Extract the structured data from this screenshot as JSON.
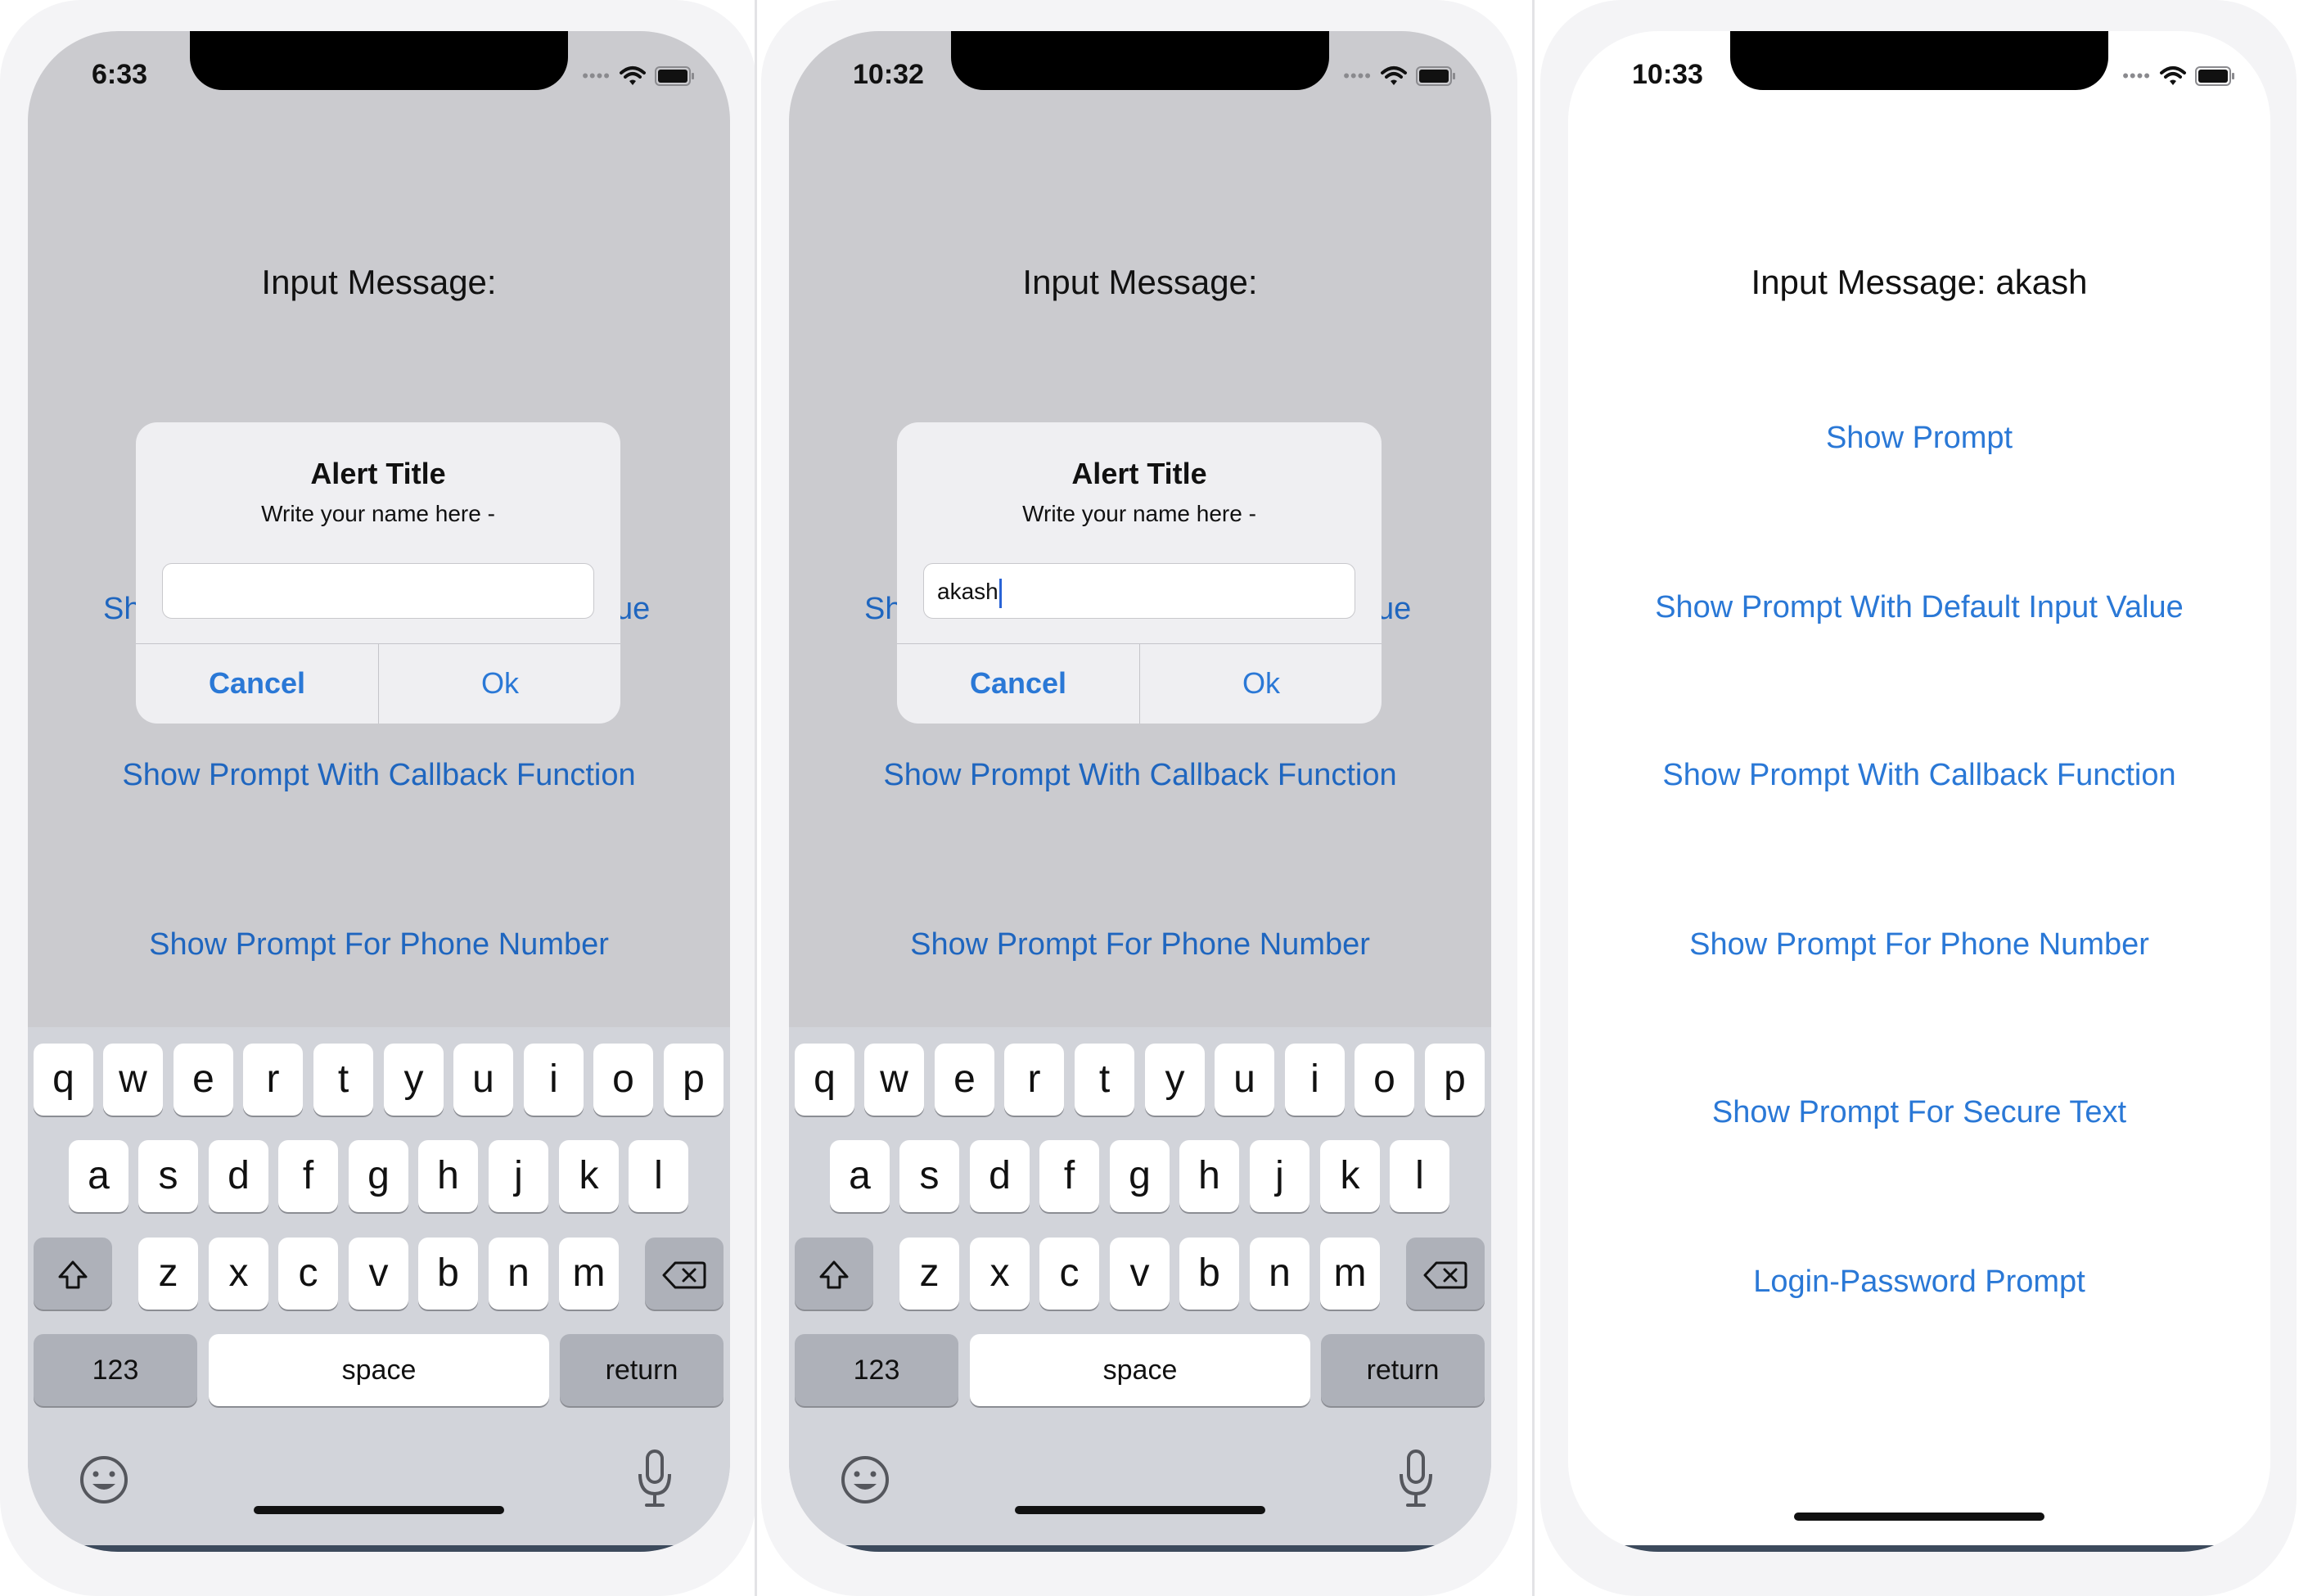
{
  "colors": {
    "link": "#2a78d6",
    "dim_bg": "#cbcbcf",
    "keyboard_bg": "#d2d4da"
  },
  "phones": [
    {
      "time": "6:33",
      "input_message": "Input Message:",
      "frag_left": "Sh",
      "frag_right": "ue",
      "buttons": [
        "Show Prompt With Callback Function",
        "Show Prompt For Phone Number"
      ],
      "alert": {
        "title": "Alert Title",
        "message": "Write your name here -",
        "input_value": "",
        "cancel": "Cancel",
        "ok": "Ok"
      }
    },
    {
      "time": "10:32",
      "input_message": "Input Message:",
      "frag_left": "Sh",
      "frag_right": "ue",
      "buttons": [
        "Show Prompt With Callback Function",
        "Show Prompt For Phone Number"
      ],
      "alert": {
        "title": "Alert Title",
        "message": "Write your name here -",
        "input_value": "akash",
        "cancel": "Cancel",
        "ok": "Ok"
      }
    },
    {
      "time": "10:33",
      "input_message": "Input Message: akash",
      "buttons": [
        "Show Prompt",
        "Show Prompt With Default Input Value",
        "Show Prompt With Callback Function",
        "Show Prompt For Phone Number",
        "Show Prompt For Secure Text",
        "Login-Password Prompt"
      ]
    }
  ],
  "keyboard": {
    "row1": [
      "q",
      "w",
      "e",
      "r",
      "t",
      "y",
      "u",
      "i",
      "o",
      "p"
    ],
    "row2": [
      "a",
      "s",
      "d",
      "f",
      "g",
      "h",
      "j",
      "k",
      "l"
    ],
    "row3": [
      "z",
      "x",
      "c",
      "v",
      "b",
      "n",
      "m"
    ],
    "numbers": "123",
    "space": "space",
    "return": "return",
    "icons": [
      "shift-icon",
      "backspace-icon",
      "emoji-icon",
      "microphone-icon"
    ]
  }
}
